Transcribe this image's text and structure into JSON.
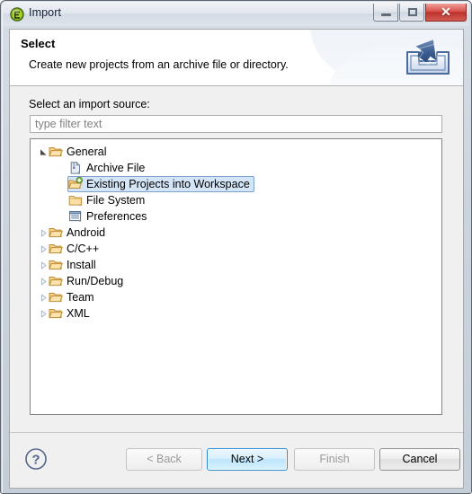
{
  "window": {
    "title": "Import",
    "title_icon": "eclipse-wizard-icon",
    "minimize_label": "Minimize",
    "maximize_label": "Maximize",
    "close_label": "Close",
    "close_glyph": "✕"
  },
  "banner": {
    "title": "Select",
    "description": "Create new projects from an archive file or directory.",
    "icon": "import-arrow-into-tray-icon"
  },
  "content": {
    "source_label": "Select an import source:",
    "filter": {
      "value": "",
      "placeholder": "type filter text"
    },
    "tree": [
      {
        "label": "General",
        "icon": "open-folder-icon",
        "level": 0,
        "state": "expanded",
        "selected": false
      },
      {
        "label": "Archive File",
        "icon": "archive-file-icon",
        "level": 1,
        "state": "leaf",
        "selected": false
      },
      {
        "label": "Existing Projects into Workspace",
        "icon": "open-folder-add-icon",
        "level": 1,
        "state": "leaf",
        "selected": true
      },
      {
        "label": "File System",
        "icon": "closed-folder-icon",
        "level": 1,
        "state": "leaf",
        "selected": false
      },
      {
        "label": "Preferences",
        "icon": "preferences-list-icon",
        "level": 1,
        "state": "leaf",
        "selected": false
      },
      {
        "label": "Android",
        "icon": "open-folder-icon",
        "level": 0,
        "state": "collapsed",
        "selected": false
      },
      {
        "label": "C/C++",
        "icon": "open-folder-icon",
        "level": 0,
        "state": "collapsed",
        "selected": false
      },
      {
        "label": "Install",
        "icon": "open-folder-icon",
        "level": 0,
        "state": "collapsed",
        "selected": false
      },
      {
        "label": "Run/Debug",
        "icon": "open-folder-icon",
        "level": 0,
        "state": "collapsed",
        "selected": false
      },
      {
        "label": "Team",
        "icon": "open-folder-icon",
        "level": 0,
        "state": "collapsed",
        "selected": false
      },
      {
        "label": "XML",
        "icon": "open-folder-icon",
        "level": 0,
        "state": "collapsed",
        "selected": false
      }
    ]
  },
  "buttons": {
    "help": {
      "label": "?",
      "name": "help-icon"
    },
    "back": {
      "label": "< Back",
      "enabled": false
    },
    "next": {
      "label": "Next >",
      "enabled": true,
      "default": true
    },
    "finish": {
      "label": "Finish",
      "enabled": false
    },
    "cancel": {
      "label": "Cancel",
      "enabled": true
    }
  },
  "colors": {
    "selection_fill": "#d3e5f7",
    "selection_border": "#7da2ce",
    "default_button_border": "#2a8ad4",
    "folder": "#f0c070",
    "title_icon_green": "#8cc63f",
    "close_button_red": "#c0392b"
  }
}
